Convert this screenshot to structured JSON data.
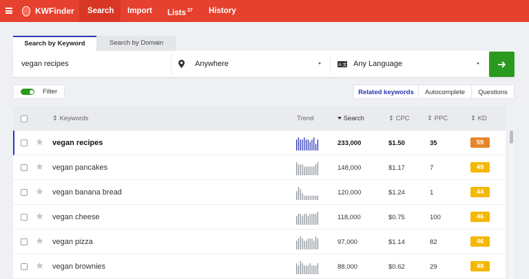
{
  "app": {
    "name": "KWFinder"
  },
  "nav": {
    "items": [
      {
        "label": "Search"
      },
      {
        "label": "Import"
      },
      {
        "label": "Lists",
        "badge": "37"
      },
      {
        "label": "History"
      }
    ]
  },
  "search_tabs": [
    "Search by Keyword",
    "Search by Domain"
  ],
  "search": {
    "keyword": "vegan recipes",
    "location": "Anywhere",
    "language": "Any Language"
  },
  "filter": {
    "label": "Filter",
    "enabled": true
  },
  "keyword_modes": [
    "Related keywords",
    "Autocomplete",
    "Questions"
  ],
  "table": {
    "headers": {
      "keywords": "⇕ Keywords",
      "trend": "Trend",
      "search": "Search",
      "cpc": "⇕ CPC",
      "ppc": "⇕ PPC",
      "kd": "⇕ KD"
    },
    "rows": [
      {
        "keyword": "vegan recipes",
        "search": "233,000",
        "cpc": "$1.50",
        "ppc": "35",
        "kd": "59",
        "kd_color": "#e8842a",
        "trend": [
          5,
          6,
          5,
          5,
          6,
          5,
          5,
          4,
          5,
          6,
          3,
          5
        ]
      },
      {
        "keyword": "vegan pancakes",
        "search": "148,000",
        "cpc": "$1.17",
        "ppc": "7",
        "kd": "49",
        "kd_color": "#f5b800",
        "trend": [
          6,
          5,
          5,
          5,
          4,
          4,
          4,
          4,
          4,
          4,
          5,
          6
        ]
      },
      {
        "keyword": "vegan banana bread",
        "search": "120,000",
        "cpc": "$1.24",
        "ppc": "1",
        "kd": "44",
        "kd_color": "#f5b800",
        "trend": [
          4,
          6,
          5,
          3,
          2,
          2,
          2,
          2,
          2,
          2,
          2,
          2
        ]
      },
      {
        "keyword": "vegan cheese",
        "search": "118,000",
        "cpc": "$0.75",
        "ppc": "100",
        "kd": "46",
        "kd_color": "#f5b800",
        "trend": [
          4,
          5,
          5,
          4,
          5,
          5,
          4,
          5,
          5,
          5,
          5,
          6
        ]
      },
      {
        "keyword": "vegan pizza",
        "search": "97,000",
        "cpc": "$1.14",
        "ppc": "82",
        "kd": "46",
        "kd_color": "#f5b800",
        "trend": [
          4,
          5,
          6,
          5,
          4,
          4,
          5,
          5,
          5,
          4,
          6,
          5
        ]
      },
      {
        "keyword": "vegan brownies",
        "search": "88,000",
        "cpc": "$0.62",
        "ppc": "29",
        "kd": "48",
        "kd_color": "#f5b800",
        "trend": [
          5,
          4,
          6,
          5,
          4,
          4,
          4,
          5,
          4,
          4,
          4,
          5
        ]
      }
    ]
  },
  "colors": {
    "brand": "#e5412e",
    "accent": "#2a36b1",
    "go": "#2a9a1e"
  },
  "icons": [
    "menu-icon",
    "location-pin-icon",
    "language-icon",
    "arrow-right-icon",
    "star-icon",
    "sort-icon"
  ]
}
